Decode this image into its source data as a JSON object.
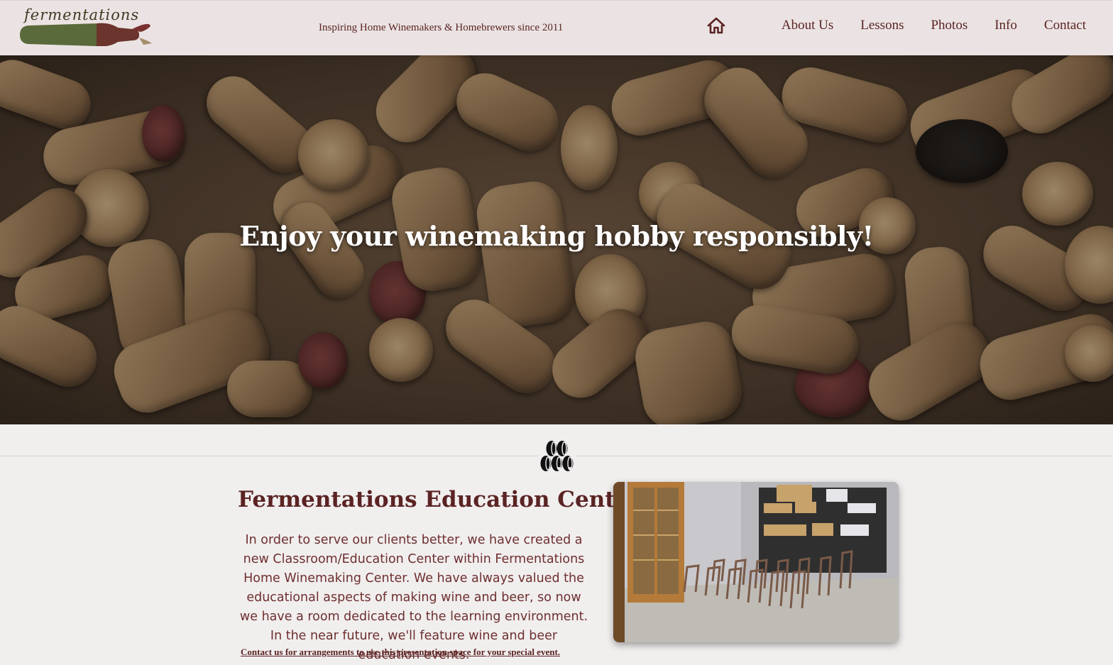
{
  "header": {
    "logo_text": "fermentations",
    "tagline": "Inspiring Home Winemakers & Homebrewers since 2011",
    "nav": {
      "home_icon": "home-icon",
      "items": [
        "About Us",
        "Lessons",
        "Photos",
        "Info",
        "Contact"
      ]
    }
  },
  "hero": {
    "title": "Enjoy your winemaking hobby responsibly!"
  },
  "divider": {
    "icon": "barrels-icon"
  },
  "section": {
    "title": "Fermentations Education Center",
    "body": "In order to serve our clients better, we have created a new Classroom/Education Center within Fermentations Home Winemaking Center. We have always valued the educational aspects of making wine and beer, so now we have a room dedicated to the learning environment. In the near future, we'll feature wine and beer education events.",
    "link": "Contact us for arrangements to use this presentation space for your special event."
  },
  "colors": {
    "brand": "#5b2323",
    "header_bg": "#ebe3e3",
    "page_bg": "#f1eeee"
  }
}
